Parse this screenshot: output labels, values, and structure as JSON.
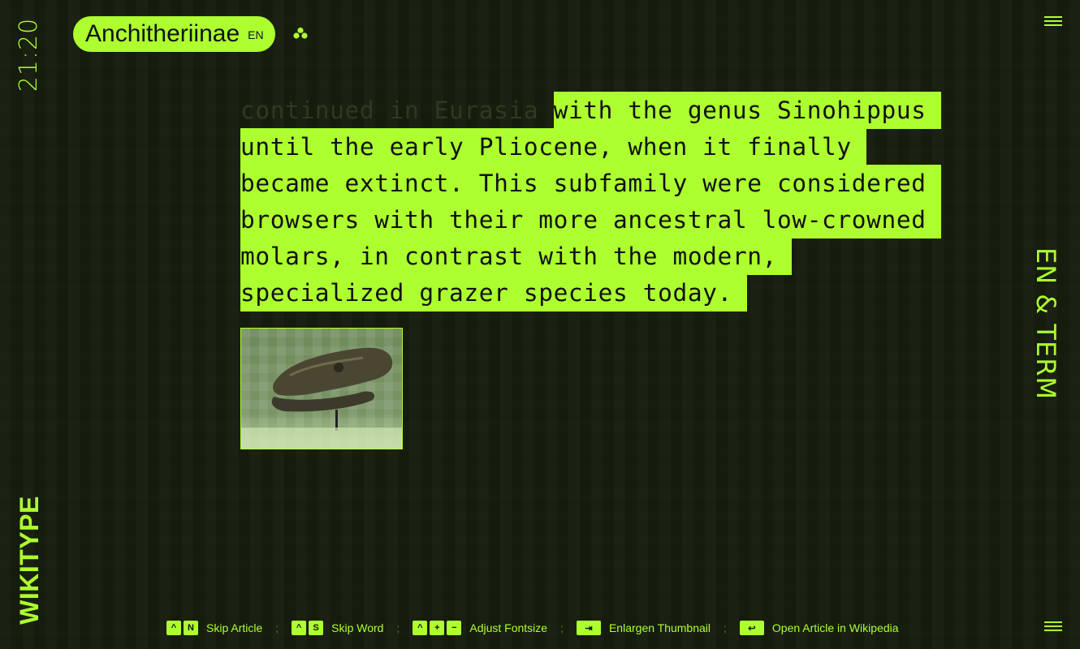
{
  "clock": "21:20",
  "brand": "WIKITYPE",
  "language_label": "EN & TERM",
  "title_pill": {
    "title": "Anchitheriinae",
    "lang": "EN"
  },
  "article": {
    "faded_text": "continued in Eurasia ",
    "highlighted_text": "with the genus Sinohippus until the early Pliocene, when it finally became extinct. This subfamily were considered browsers with their more ancestral low-crowned molars, in contrast with the modern, specialized grazer species today."
  },
  "shortcuts": [
    {
      "keys": [
        "^",
        "N"
      ],
      "label": "Skip Article"
    },
    {
      "keys": [
        "^",
        "S"
      ],
      "label": "Skip Word"
    },
    {
      "keys": [
        "^",
        "+",
        "−"
      ],
      "label": "Adjust Fontsize"
    },
    {
      "keys": [
        "⇥"
      ],
      "label": "Enlargen Thumbnail"
    },
    {
      "keys": [
        "↩"
      ],
      "label": "Open Article in Wikipedia"
    }
  ],
  "separator": ";",
  "colors": {
    "accent": "#adff2f",
    "background": "#161d0e"
  },
  "icons": {
    "clover": "clover-icon",
    "menu": "hamburger-menu-icon"
  }
}
